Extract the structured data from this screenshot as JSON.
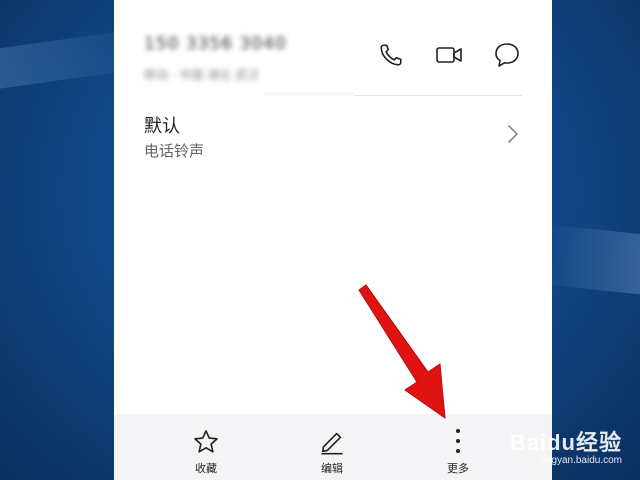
{
  "contact": {
    "phone_number": "150 3356 3040",
    "location": "移动 · 中国 湖北 武汉"
  },
  "actions": {
    "call_icon": "phone-icon",
    "video_icon": "video-call-icon",
    "message_icon": "message-icon"
  },
  "ringtone": {
    "title": "默认",
    "subtitle": "电话铃声"
  },
  "bottom_bar": {
    "favorite_label": "收藏",
    "edit_label": "编辑",
    "more_label": "更多"
  },
  "watermark": {
    "brand": "Baidu经验",
    "url": "jingyan.baidu.com"
  },
  "colors": {
    "arrow": "#e01212",
    "desktop": "#124a8c",
    "bottom_bar": "#f4f3f5"
  }
}
